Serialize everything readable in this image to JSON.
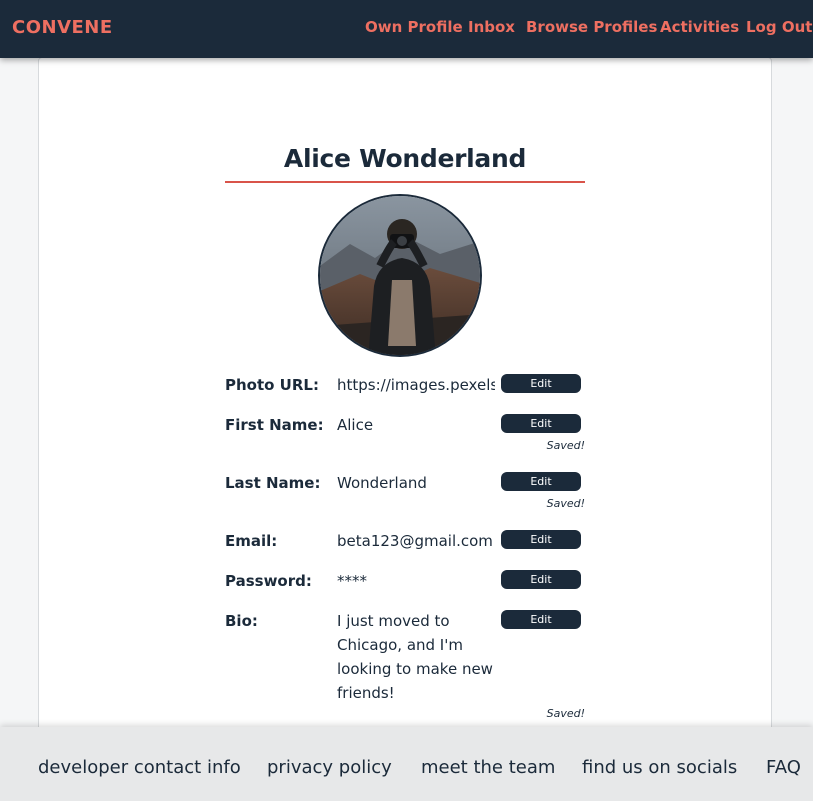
{
  "brand": "CONVENE",
  "nav": {
    "own_profile": "Own Profile",
    "inbox": "Inbox",
    "browse_profiles": "Browse Profiles",
    "activities": "Activities",
    "log_out": "Log Out"
  },
  "profile": {
    "name": "Alice Wonderland",
    "photo_alt": "Profile photo"
  },
  "fields": {
    "photo_url": {
      "label": "Photo URL:",
      "value": "https://images.pexels.c",
      "edit": "Edit"
    },
    "first_name": {
      "label": "First Name:",
      "value": "Alice",
      "edit": "Edit",
      "status": "Saved!"
    },
    "last_name": {
      "label": "Last Name:",
      "value": "Wonderland",
      "edit": "Edit",
      "status": "Saved!"
    },
    "email": {
      "label": "Email:",
      "value": "beta123@gmail.com",
      "edit": "Edit"
    },
    "password": {
      "label": "Password:",
      "value": "****",
      "edit": "Edit"
    },
    "bio": {
      "label": "Bio:",
      "value": "I just moved to Chicago, and I'm looking to make new friends!",
      "edit": "Edit",
      "status": "Saved!"
    }
  },
  "footer": {
    "developer_contact": "developer contact info",
    "privacy_policy": "privacy policy",
    "meet_the_team": "meet the team",
    "socials": "find us on socials",
    "faq": "FAQ"
  },
  "colors": {
    "nav_bg": "#1b2a3a",
    "accent": "#ee6f61",
    "button_bg": "#1b2a3a",
    "footer_bg": "#e7e8e9"
  }
}
